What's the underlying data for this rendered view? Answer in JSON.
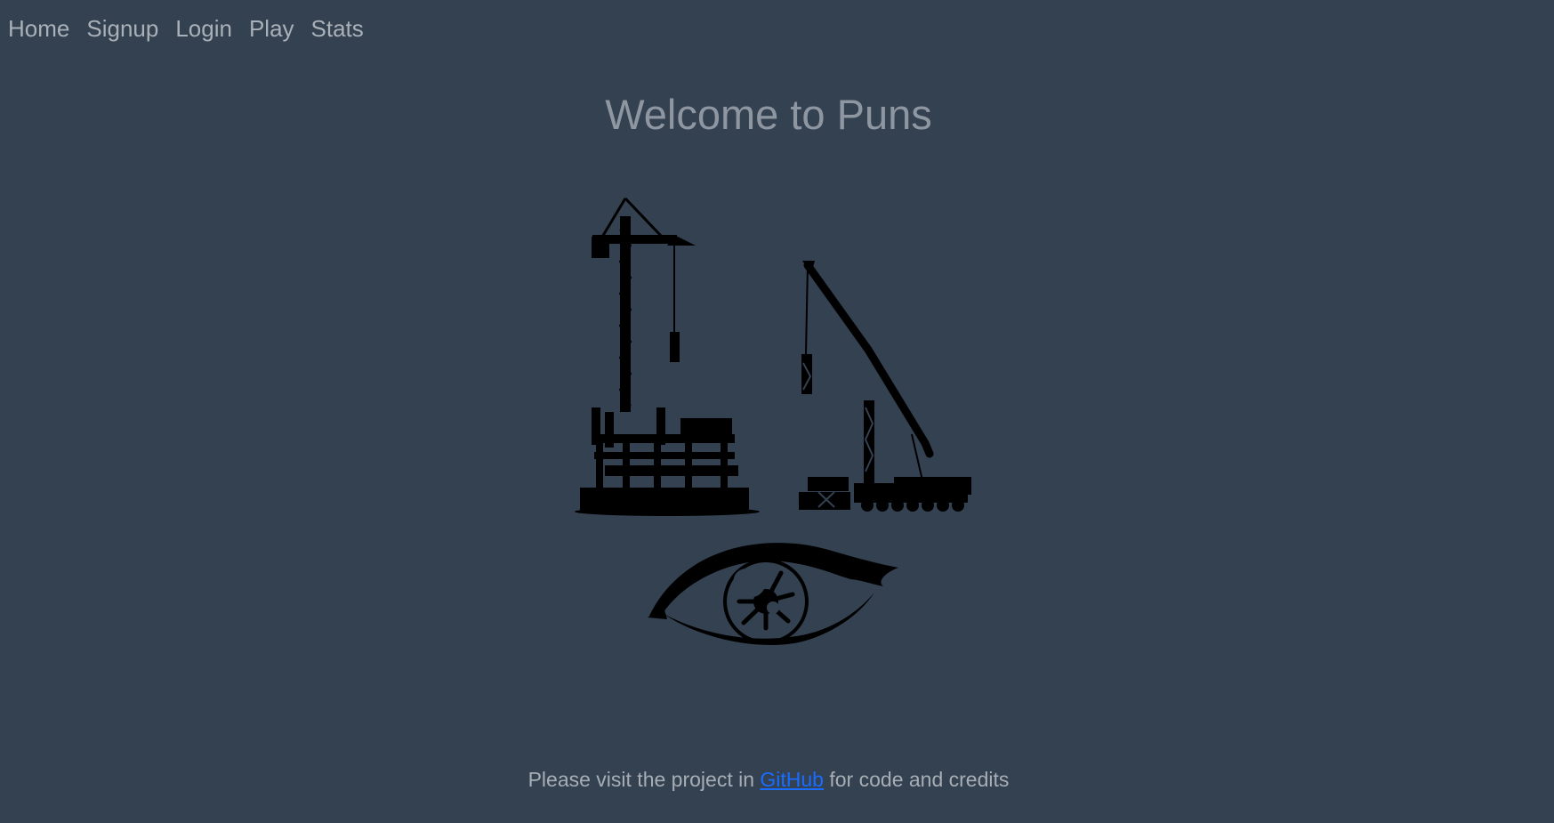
{
  "nav": {
    "items": [
      {
        "label": "Home"
      },
      {
        "label": "Signup"
      },
      {
        "label": "Login"
      },
      {
        "label": "Play"
      },
      {
        "label": "Stats"
      }
    ]
  },
  "main": {
    "title": "Welcome to Puns",
    "illustration": "construction-cranes",
    "logo": "eye-icon"
  },
  "footer": {
    "prefix": "Please visit the project in ",
    "link_label": "GitHub",
    "suffix": " for code and credits"
  },
  "colors": {
    "background": "#334150",
    "nav_text": "#aab0b8",
    "title_text": "#8e96a1",
    "footer_text": "#a7adb5",
    "link": "#1a6cff",
    "silhouette": "#000000"
  }
}
